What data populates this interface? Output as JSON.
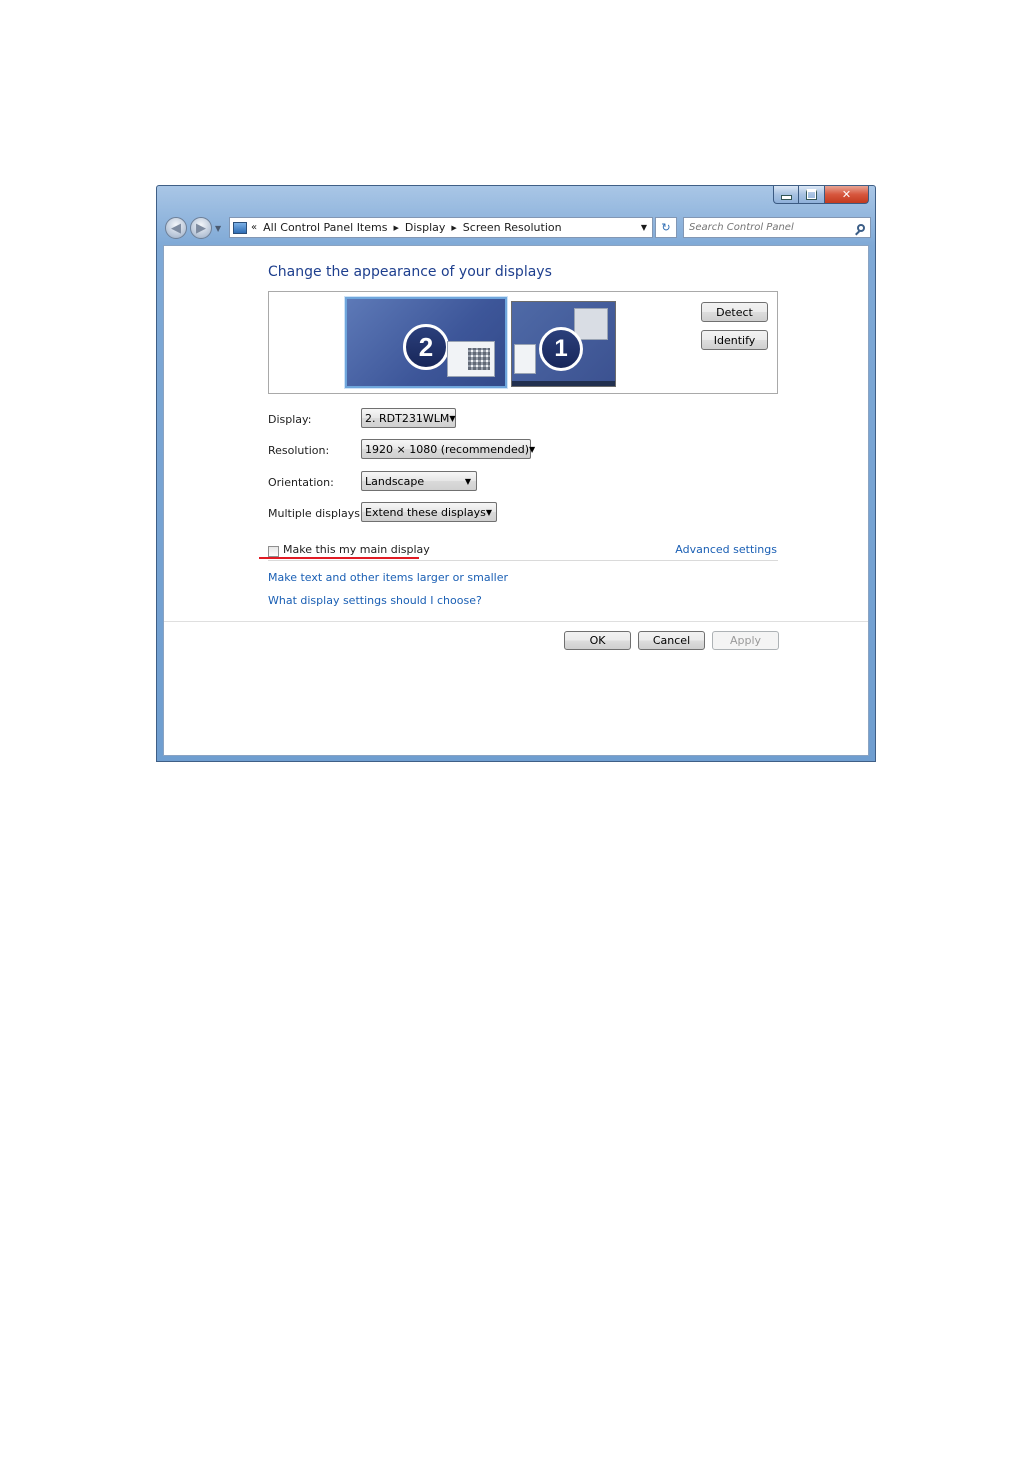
{
  "address_bar": {
    "overflow": "«",
    "crumbs": [
      "All Control Panel Items",
      "Display",
      "Screen Resolution"
    ]
  },
  "search": {
    "placeholder": "Search Control Panel"
  },
  "heading": "Change the appearance of your displays",
  "monitors": [
    {
      "number": "2",
      "selected": true
    },
    {
      "number": "1",
      "selected": false
    }
  ],
  "buttons": {
    "detect": "Detect",
    "identify": "Identify",
    "ok": "OK",
    "cancel": "Cancel",
    "apply": "Apply"
  },
  "settings": {
    "display": {
      "label": "Display:",
      "value": "2. RDT231WLM"
    },
    "resolution": {
      "label": "Resolution:",
      "value": "1920 × 1080 (recommended)"
    },
    "orientation": {
      "label": "Orientation:",
      "value": "Landscape"
    },
    "multiple_displays": {
      "label": "Multiple displays:",
      "value": "Extend these displays"
    }
  },
  "main_display": {
    "label": "Make this my main display",
    "checked": false
  },
  "links": {
    "advanced": "Advanced settings",
    "text_size": "Make text and other items larger or smaller",
    "help": "What display settings should I choose?"
  },
  "colors": {
    "accent_heading": "#1e3f8e",
    "link": "#1a5fb4",
    "annotation_underline": "#e01b24"
  }
}
